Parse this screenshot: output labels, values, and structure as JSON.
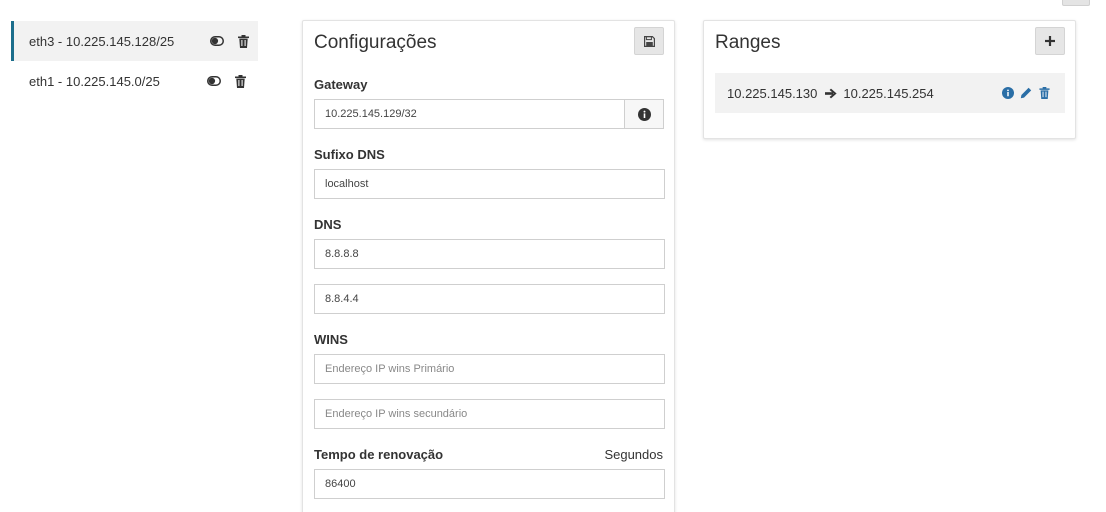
{
  "interfaces": [
    {
      "label": "eth3 - 10.225.145.128/25",
      "active": true
    },
    {
      "label": "eth1 - 10.225.145.0/25",
      "active": false
    }
  ],
  "config": {
    "title": "Configurações",
    "gateway_label": "Gateway",
    "gateway_value": "10.225.145.129/32",
    "dns_suffix_label": "Sufixo DNS",
    "dns_suffix_value": "localhost",
    "dns_label": "DNS",
    "dns_primary_value": "8.8.8.8",
    "dns_secondary_value": "8.8.4.4",
    "wins_label": "WINS",
    "wins_primary_placeholder": "Endereço IP wins Primário",
    "wins_secondary_placeholder": "Endereço IP wins secundário",
    "lease_label": "Tempo de renovação",
    "lease_unit": "Segundos",
    "lease_value": "86400"
  },
  "ranges": {
    "title": "Ranges",
    "items": [
      {
        "start": "10.225.145.130",
        "end": "10.225.145.254"
      }
    ]
  },
  "colors": {
    "accent": "#1c6e8c",
    "icon_blue": "#2a6ea6",
    "icon_dark": "#333333"
  },
  "icons": {
    "toggle": "toggle-icon",
    "delete": "trash-icon",
    "save": "floppy-disk-icon",
    "info": "info-circle-icon",
    "add": "plus-icon",
    "arrow": "arrow-right-icon",
    "edit": "pencil-icon"
  }
}
